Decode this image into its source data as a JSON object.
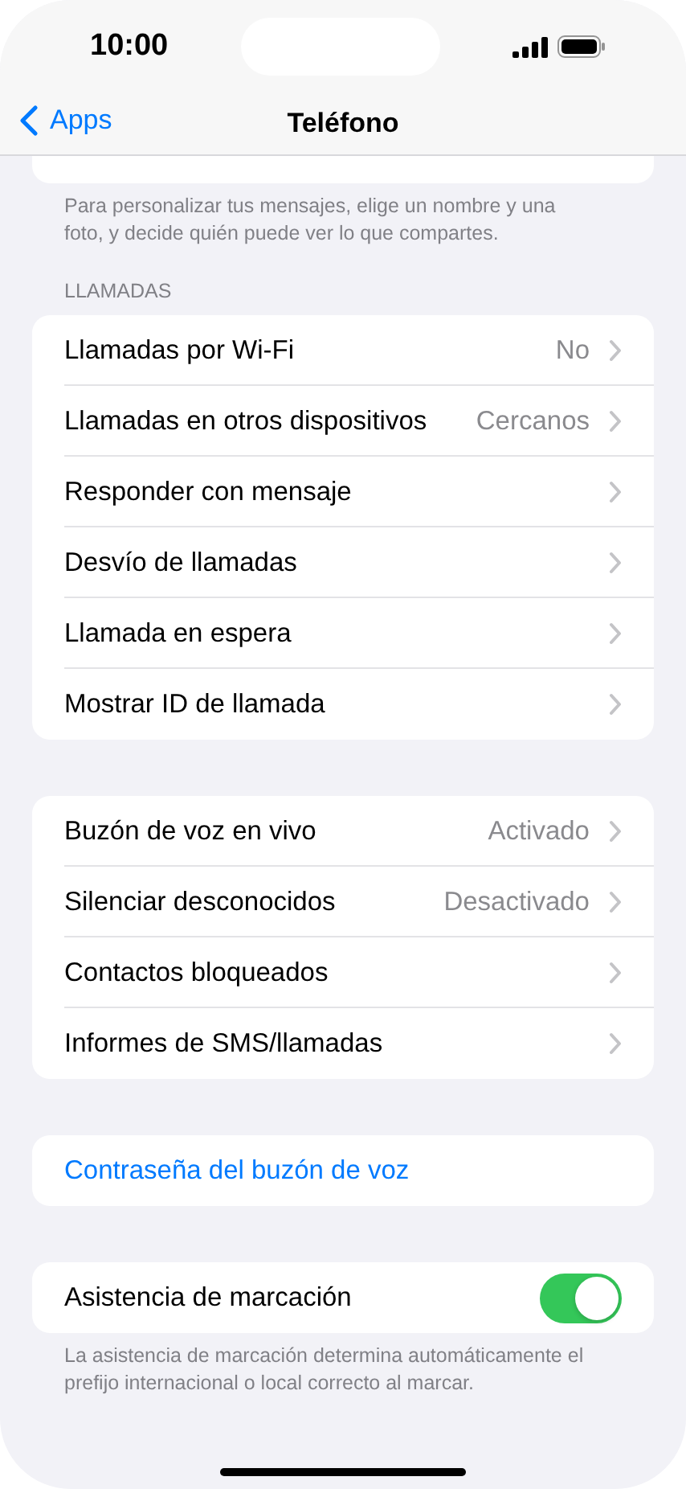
{
  "status_bar": {
    "time": "10:00"
  },
  "nav": {
    "back": "Apps",
    "title": "Teléfono"
  },
  "top_footer": "Para personalizar tus mensajes, elige un nombre y una foto, y decide quién puede ver lo que compartes.",
  "groups": [
    {
      "header": "LLAMADAS",
      "rows": [
        {
          "kind": "link",
          "label": "Llamadas por Wi-Fi",
          "value": "No"
        },
        {
          "kind": "link",
          "label": "Llamadas en otros dispositivos",
          "value": "Cercanos"
        },
        {
          "kind": "link",
          "label": "Responder con mensaje"
        },
        {
          "kind": "link",
          "label": "Desvío de llamadas"
        },
        {
          "kind": "link",
          "label": "Llamada en espera"
        },
        {
          "kind": "link",
          "label": "Mostrar ID de llamada"
        }
      ]
    },
    {
      "rows": [
        {
          "kind": "link",
          "label": "Buzón de voz en vivo",
          "value": "Activado"
        },
        {
          "kind": "link",
          "label": "Silenciar desconocidos",
          "value": "Desactivado"
        },
        {
          "kind": "link",
          "label": "Contactos bloqueados"
        },
        {
          "kind": "link",
          "label": "Informes de SMS/llamadas"
        }
      ]
    },
    {
      "rows": [
        {
          "kind": "action",
          "label": "Contraseña del buzón de voz"
        }
      ]
    },
    {
      "rows": [
        {
          "kind": "toggle",
          "label": "Asistencia de marcación",
          "on": true
        }
      ],
      "footer": "La asistencia de marcación determina automáticamente el prefijo internacional o local correcto al marcar."
    }
  ]
}
